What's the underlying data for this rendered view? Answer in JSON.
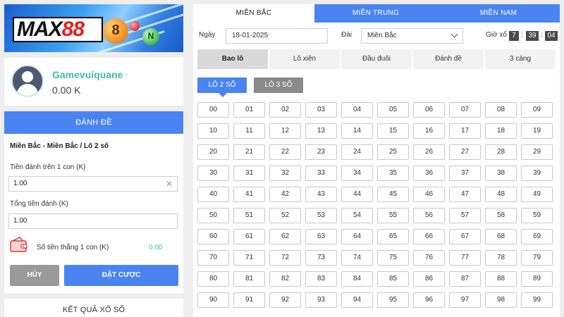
{
  "brand": {
    "logo_text_1": "MAX",
    "logo_text_2": "88",
    "ball_orange": "8",
    "ball_green": "N"
  },
  "user": {
    "name": "Gamevuiquane",
    "balance": "0.00 K"
  },
  "bet_panel": {
    "header": "ĐÁNH ĐỀ",
    "path": "Miền Bắc - Miền Bắc / Lô 2 số",
    "stake_label": "Tiền đánh trên 1 con (K)",
    "stake_value": "1.00",
    "total_label": "Tổng tiền đánh (K)",
    "total_value": "1.00",
    "win_label": "Số tiền thắng 1 con (K)",
    "win_value": "0.00",
    "cancel_label": "HỦY",
    "place_label": "ĐẶT CƯỢC"
  },
  "results": {
    "title": "KẾT QUẢ XỔ SỐ"
  },
  "region_tabs": [
    "MIỀN BẮC",
    "MIỀN TRUNG",
    "MIỀN NAM"
  ],
  "active_region": 0,
  "filters": {
    "date_label": "Ngày",
    "date_value": "18-01-2025",
    "station_label": "Đài",
    "station_value": "Miền Bắc",
    "time_label": "Giờ xổ",
    "time_h": "7",
    "time_m": "39",
    "time_s": "04"
  },
  "type_tabs": [
    "Bao lô",
    "Lô xiên",
    "Đầu đuôi",
    "Đánh đề",
    "3 càng"
  ],
  "active_type": 0,
  "sub_tabs": [
    "LÔ 2 SỐ",
    "LÔ 3 SỐ"
  ],
  "numbers": [
    "00",
    "01",
    "02",
    "03",
    "04",
    "05",
    "06",
    "07",
    "08",
    "09",
    "10",
    "11",
    "12",
    "13",
    "14",
    "15",
    "16",
    "17",
    "18",
    "19",
    "20",
    "21",
    "22",
    "23",
    "24",
    "25",
    "26",
    "27",
    "28",
    "29",
    "30",
    "31",
    "32",
    "33",
    "34",
    "35",
    "36",
    "37",
    "38",
    "39",
    "40",
    "41",
    "42",
    "43",
    "44",
    "45",
    "46",
    "47",
    "48",
    "49",
    "50",
    "51",
    "52",
    "53",
    "54",
    "55",
    "56",
    "57",
    "58",
    "59",
    "60",
    "61",
    "62",
    "63",
    "64",
    "65",
    "66",
    "67",
    "68",
    "69",
    "70",
    "71",
    "72",
    "73",
    "74",
    "75",
    "76",
    "77",
    "78",
    "79",
    "80",
    "81",
    "82",
    "83",
    "84",
    "85",
    "86",
    "87",
    "88",
    "89",
    "90",
    "91",
    "92",
    "93",
    "94",
    "95",
    "96",
    "97",
    "98",
    "99"
  ],
  "colors": {
    "primary": "#4a84f0",
    "accent_teal": "#3fbfa3",
    "cancel_gray": "#9a9a9a"
  }
}
